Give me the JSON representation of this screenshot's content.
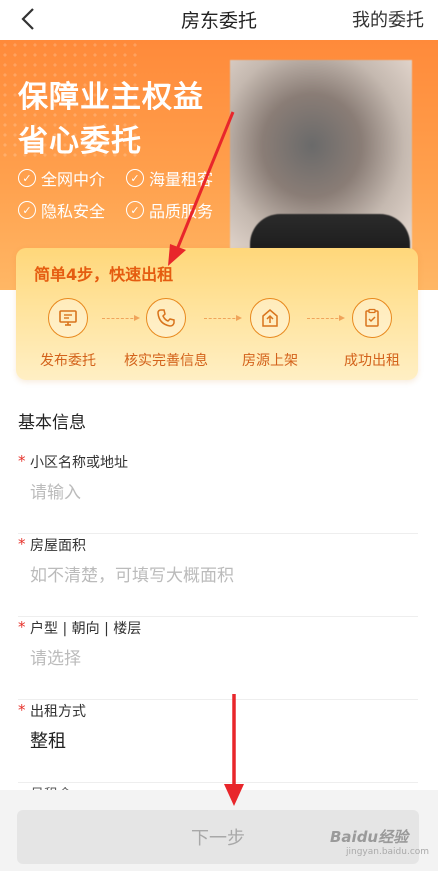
{
  "nav": {
    "title": "房东委托",
    "right_link": "我的委托"
  },
  "hero": {
    "headline_1": "保障业主权益",
    "headline_2": "省心委托",
    "features": [
      "全网中介",
      "海量租客",
      "隐私安全",
      "品质服务"
    ]
  },
  "steps": {
    "title": "简单4步，快速出租",
    "items": [
      {
        "label": "发布委托",
        "icon": "monitor-icon"
      },
      {
        "label": "核实完善信息",
        "icon": "phone-icon"
      },
      {
        "label": "房源上架",
        "icon": "upload-icon"
      },
      {
        "label": "成功出租",
        "icon": "clipboard-check-icon"
      }
    ]
  },
  "form": {
    "section_title": "基本信息",
    "fields": [
      {
        "label": "小区名称或地址",
        "placeholder": "请输入"
      },
      {
        "label": "房屋面积",
        "placeholder": "如不清楚，可填写大概面积"
      },
      {
        "label": "户型 | 朝向 | 楼层",
        "placeholder": "请选择"
      },
      {
        "label": "出租方式",
        "value": "整租"
      }
    ],
    "partial_next_label": "月租金"
  },
  "footer": {
    "next_button": "下一步"
  },
  "watermark": {
    "brand": "Baidu经验",
    "url": "jingyan.baidu.com"
  },
  "colors": {
    "accent": "#ff8a3a",
    "step_text": "#d3621b",
    "required": "#e6322b",
    "annotation": "#e8262b"
  }
}
